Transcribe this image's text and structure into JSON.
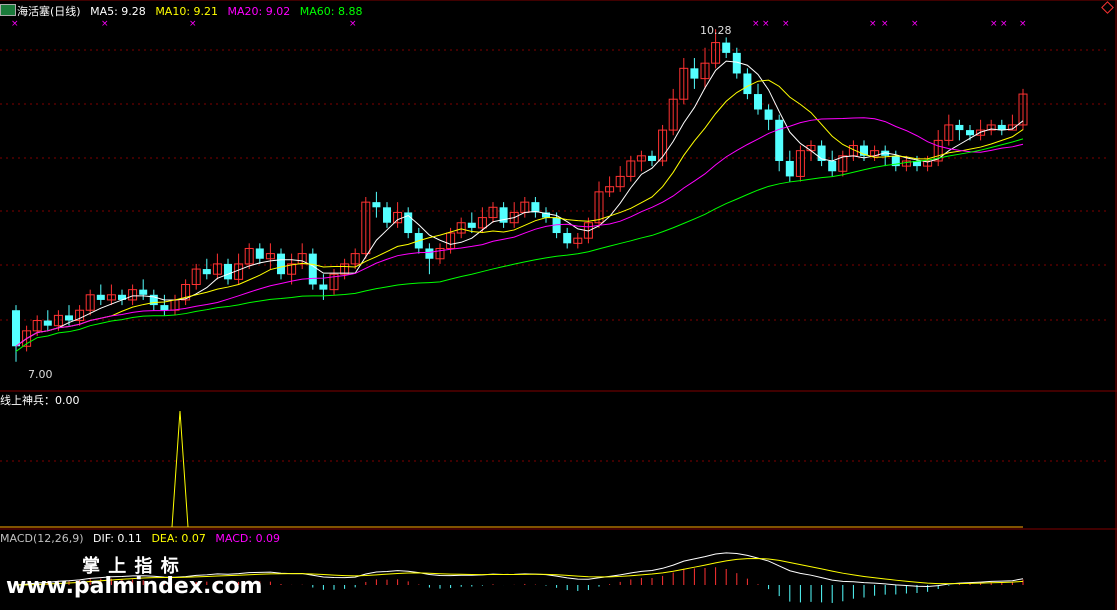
{
  "main_panel": {
    "title": "海活塞(日线)",
    "ma_labels": [
      {
        "label": "MA5: 9.28",
        "color": "#ffffff"
      },
      {
        "label": "MA10: 9.21",
        "color": "#ffff00"
      },
      {
        "label": "MA20: 9.02",
        "color": "#ff00ff"
      },
      {
        "label": "MA60: 8.88",
        "color": "#00ff00"
      }
    ],
    "high_label": "10.28",
    "low_label": "7.00"
  },
  "indicator_panel": {
    "label": "线上神兵：0.00"
  },
  "macd_panel": {
    "labels": [
      {
        "label": "MACD(12,26,9)",
        "color": "#c0c0c0"
      },
      {
        "label": "DIF: 0.11",
        "color": "#ffffff"
      },
      {
        "label": "DEA: 0.07",
        "color": "#ffff00"
      },
      {
        "label": "MACD: 0.09",
        "color": "#ff00ff"
      }
    ]
  },
  "watermark": {
    "line1": "掌 上 指 标",
    "line2": "www.palmindex.com"
  },
  "colors": {
    "up": "#ff3232",
    "down": "#54ffff",
    "ma5": "#ffffff",
    "ma10": "#ffff00",
    "ma20": "#ff00ff",
    "ma60": "#00ff00",
    "grid": "#800000",
    "border": "#800000"
  },
  "chart_data": {
    "type": "candlestick",
    "price_range": [
      7.0,
      10.28
    ],
    "candles": [
      [
        7.55,
        7.2,
        7.6,
        7.05
      ],
      [
        7.2,
        7.35,
        7.4,
        7.15
      ],
      [
        7.35,
        7.45,
        7.5,
        7.3
      ],
      [
        7.45,
        7.4,
        7.55,
        7.35
      ],
      [
        7.4,
        7.5,
        7.55,
        7.35
      ],
      [
        7.5,
        7.45,
        7.6,
        7.4
      ],
      [
        7.45,
        7.55,
        7.6,
        7.4
      ],
      [
        7.55,
        7.7,
        7.75,
        7.5
      ],
      [
        7.7,
        7.65,
        7.8,
        7.6
      ],
      [
        7.65,
        7.7,
        7.8,
        7.6
      ],
      [
        7.7,
        7.65,
        7.75,
        7.6
      ],
      [
        7.65,
        7.75,
        7.8,
        7.6
      ],
      [
        7.75,
        7.7,
        7.85,
        7.65
      ],
      [
        7.7,
        7.6,
        7.75,
        7.55
      ],
      [
        7.6,
        7.55,
        7.7,
        7.5
      ],
      [
        7.55,
        7.65,
        7.7,
        7.5
      ],
      [
        7.65,
        7.8,
        7.85,
        7.6
      ],
      [
        7.8,
        7.95,
        8.0,
        7.75
      ],
      [
        7.95,
        7.9,
        8.05,
        7.85
      ],
      [
        7.9,
        8.0,
        8.1,
        7.85
      ],
      [
        8.0,
        7.85,
        8.05,
        7.8
      ],
      [
        7.85,
        8.0,
        8.1,
        7.8
      ],
      [
        8.0,
        8.15,
        8.2,
        7.95
      ],
      [
        8.15,
        8.05,
        8.2,
        8.0
      ],
      [
        8.05,
        8.1,
        8.2,
        7.95
      ],
      [
        8.1,
        7.9,
        8.15,
        7.85
      ],
      [
        7.9,
        8.0,
        8.1,
        7.8
      ],
      [
        8.0,
        8.1,
        8.2,
        7.95
      ],
      [
        8.1,
        7.8,
        8.15,
        7.75
      ],
      [
        7.8,
        7.75,
        7.9,
        7.65
      ],
      [
        7.75,
        7.9,
        7.95,
        7.7
      ],
      [
        7.9,
        8.0,
        8.05,
        7.85
      ],
      [
        8.0,
        8.1,
        8.15,
        7.95
      ],
      [
        8.1,
        8.6,
        8.65,
        8.05
      ],
      [
        8.6,
        8.55,
        8.7,
        8.45
      ],
      [
        8.55,
        8.4,
        8.6,
        8.35
      ],
      [
        8.4,
        8.5,
        8.6,
        8.35
      ],
      [
        8.5,
        8.3,
        8.55,
        8.25
      ],
      [
        8.3,
        8.15,
        8.35,
        8.1
      ],
      [
        8.15,
        8.05,
        8.2,
        7.9
      ],
      [
        8.05,
        8.15,
        8.2,
        8.0
      ],
      [
        8.15,
        8.3,
        8.35,
        8.1
      ],
      [
        8.3,
        8.4,
        8.45,
        8.25
      ],
      [
        8.4,
        8.35,
        8.5,
        8.3
      ],
      [
        8.35,
        8.45,
        8.55,
        8.3
      ],
      [
        8.45,
        8.55,
        8.6,
        8.4
      ],
      [
        8.55,
        8.4,
        8.6,
        8.35
      ],
      [
        8.4,
        8.5,
        8.6,
        8.35
      ],
      [
        8.5,
        8.6,
        8.65,
        8.45
      ],
      [
        8.6,
        8.5,
        8.65,
        8.45
      ],
      [
        8.5,
        8.45,
        8.55,
        8.4
      ],
      [
        8.45,
        8.3,
        8.5,
        8.25
      ],
      [
        8.3,
        8.2,
        8.35,
        8.15
      ],
      [
        8.2,
        8.25,
        8.3,
        8.15
      ],
      [
        8.25,
        8.4,
        8.45,
        8.2
      ],
      [
        8.4,
        8.7,
        8.8,
        8.35
      ],
      [
        8.7,
        8.75,
        8.85,
        8.65
      ],
      [
        8.75,
        8.85,
        8.95,
        8.7
      ],
      [
        8.85,
        9.0,
        9.05,
        8.8
      ],
      [
        9.0,
        9.05,
        9.1,
        8.9
      ],
      [
        9.05,
        9.0,
        9.1,
        8.95
      ],
      [
        9.0,
        9.3,
        9.35,
        8.95
      ],
      [
        9.3,
        9.6,
        9.7,
        9.25
      ],
      [
        9.6,
        9.9,
        10.0,
        9.55
      ],
      [
        9.9,
        9.8,
        10.0,
        9.7
      ],
      [
        9.8,
        9.95,
        10.1,
        9.7
      ],
      [
        9.95,
        10.15,
        10.28,
        9.9
      ],
      [
        10.15,
        10.05,
        10.2,
        10.0
      ],
      [
        10.05,
        9.85,
        10.1,
        9.8
      ],
      [
        9.85,
        9.65,
        9.9,
        9.6
      ],
      [
        9.65,
        9.5,
        9.75,
        9.45
      ],
      [
        9.5,
        9.4,
        9.55,
        9.3
      ],
      [
        9.4,
        9.0,
        9.45,
        8.9
      ],
      [
        9.0,
        8.85,
        9.1,
        8.8
      ],
      [
        8.85,
        9.1,
        9.15,
        8.8
      ],
      [
        9.1,
        9.15,
        9.2,
        9.0
      ],
      [
        9.15,
        9.0,
        9.2,
        8.95
      ],
      [
        9.0,
        8.9,
        9.1,
        8.85
      ],
      [
        8.9,
        9.05,
        9.1,
        8.85
      ],
      [
        9.05,
        9.15,
        9.2,
        9.0
      ],
      [
        9.15,
        9.05,
        9.2,
        9.0
      ],
      [
        9.05,
        9.1,
        9.15,
        9.0
      ],
      [
        9.1,
        9.05,
        9.15,
        8.95
      ],
      [
        9.05,
        8.95,
        9.1,
        8.9
      ],
      [
        8.95,
        9.0,
        9.05,
        8.9
      ],
      [
        9.0,
        8.95,
        9.05,
        8.9
      ],
      [
        8.95,
        9.0,
        9.05,
        8.9
      ],
      [
        9.0,
        9.2,
        9.3,
        8.95
      ],
      [
        9.2,
        9.35,
        9.45,
        9.15
      ],
      [
        9.35,
        9.3,
        9.4,
        9.2
      ],
      [
        9.3,
        9.25,
        9.35,
        9.2
      ],
      [
        9.25,
        9.3,
        9.4,
        9.2
      ],
      [
        9.3,
        9.35,
        9.4,
        9.25
      ],
      [
        9.35,
        9.3,
        9.4,
        9.25
      ],
      [
        9.3,
        9.35,
        9.45,
        9.3
      ],
      [
        9.35,
        9.65,
        9.7,
        9.3
      ]
    ],
    "macd_hist_peak_index": 9
  }
}
